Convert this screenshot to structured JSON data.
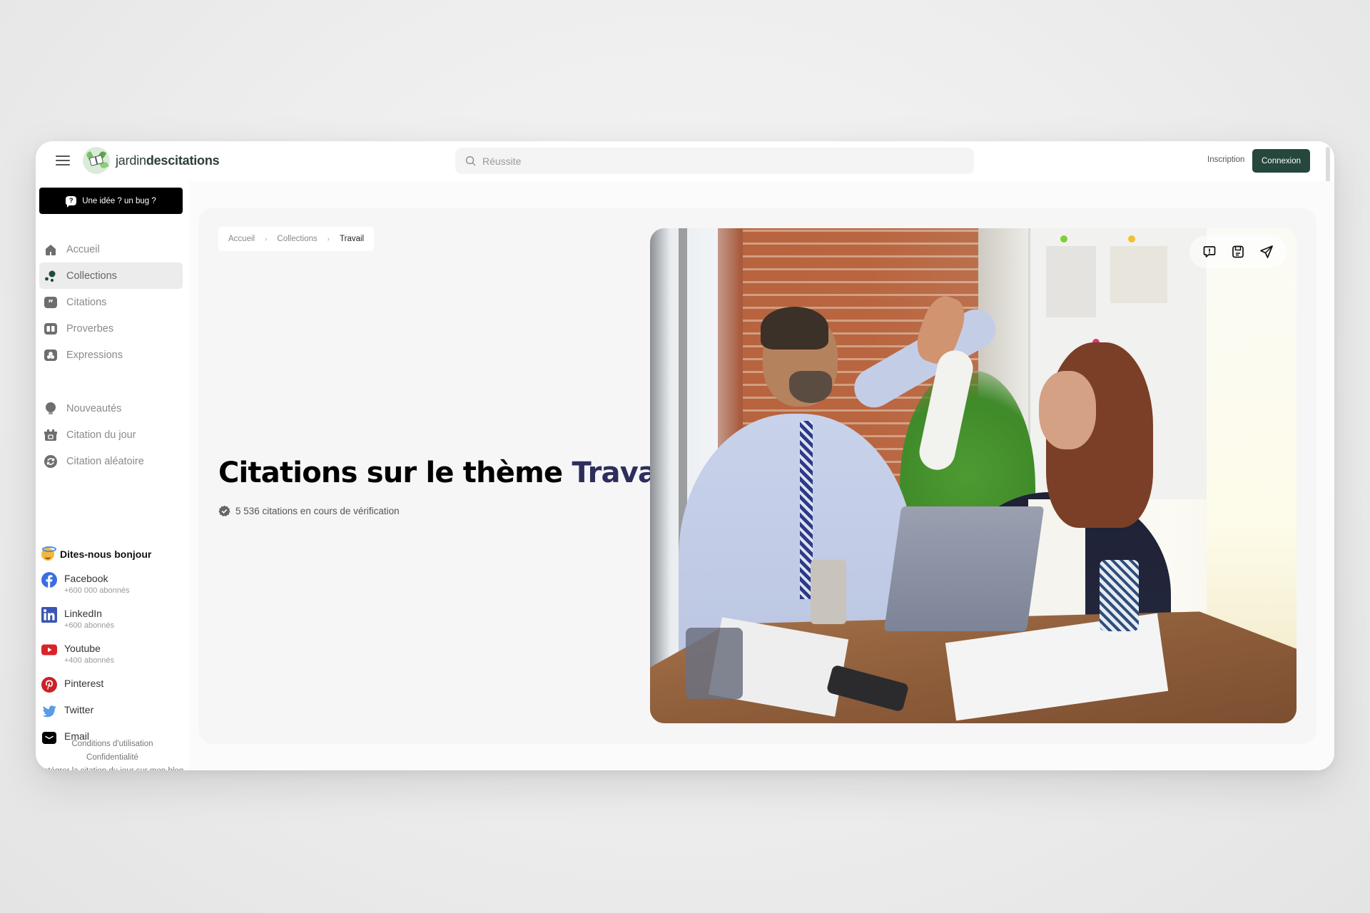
{
  "header": {
    "brand_light": "jardin",
    "brand_bold": "descitations",
    "search_placeholder": "Réussite",
    "signup_label": "Inscription",
    "login_label": "Connexion"
  },
  "sidebar": {
    "idea_button": "Une idée ? un bug ?",
    "nav_primary": [
      {
        "label": "Accueil",
        "icon": "home-icon",
        "active": false
      },
      {
        "label": "Collections",
        "icon": "collections-icon",
        "active": true
      },
      {
        "label": "Citations",
        "icon": "quote-icon",
        "active": false
      },
      {
        "label": "Proverbes",
        "icon": "book-icon",
        "active": false
      },
      {
        "label": "Expressions",
        "icon": "expressions-icon",
        "active": false
      }
    ],
    "nav_secondary": [
      {
        "label": "Nouveautés",
        "icon": "lightbulb-icon"
      },
      {
        "label": "Citation du jour",
        "icon": "calendar-gift-icon"
      },
      {
        "label": "Citation aléatoire",
        "icon": "refresh-icon"
      }
    ],
    "social_title": "Dites-nous bonjour",
    "social": [
      {
        "name": "Facebook",
        "sub": "+600 000 abonnés",
        "icon": "facebook-icon",
        "color": "#3b6fe0"
      },
      {
        "name": "LinkedIn",
        "sub": "+600 abonnés",
        "icon": "linkedin-icon",
        "color": "#3a55b4"
      },
      {
        "name": "Youtube",
        "sub": "+400 abonnés",
        "icon": "youtube-icon",
        "color": "#d9232a"
      },
      {
        "name": "Pinterest",
        "sub": "",
        "icon": "pinterest-icon",
        "color": "#cc2127"
      },
      {
        "name": "Twitter",
        "sub": "",
        "icon": "twitter-icon",
        "color": "#5a9be8"
      },
      {
        "name": "Email",
        "sub": "",
        "icon": "email-icon",
        "color": "#000000"
      }
    ],
    "footer_links": [
      "Conditions d'utilisation",
      "Confidentialité",
      "Intégrer la citation du jour sur mon blog"
    ]
  },
  "main": {
    "breadcrumb": [
      "Accueil",
      "Collections",
      "Travail"
    ],
    "title_prefix": "Citations sur le thème",
    "title_accent": "Travail",
    "meta_text": "5 536 citations en cours de vérification",
    "photo_alt": "Deux collègues se tapent dans la main autour d'une table de bureau",
    "photo_actions": [
      "report-icon",
      "save-icon",
      "share-icon"
    ]
  },
  "colors": {
    "brand_dark": "#25473d",
    "accent_title": "#2e2e5c",
    "active_bg": "#ececec"
  }
}
